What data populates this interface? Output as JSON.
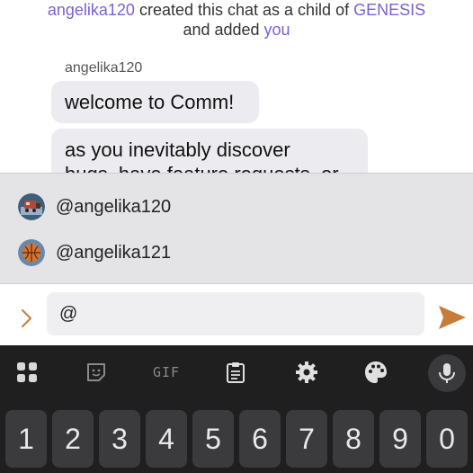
{
  "chat": {
    "system_message": {
      "creator": "angelika120",
      "text_mid": " created this chat as a child of ",
      "parent": "GENESIS",
      "text_end": "and added ",
      "target": "you"
    },
    "messages": [
      {
        "author": "angelika120",
        "text": "welcome to Comm!"
      },
      {
        "text": "as you inevitably discover",
        "text_cut": "bugs, have feature requests, or"
      }
    ]
  },
  "mentions": [
    {
      "label": "@angelika120",
      "avatar_icon": "train-avatar-icon"
    },
    {
      "label": "@angelika121",
      "avatar_icon": "basketball-avatar-icon"
    }
  ],
  "composer": {
    "value": "@",
    "expand_icon": "chevron-right-icon",
    "send_icon": "send-icon"
  },
  "keyboard": {
    "toolbar": [
      "apps-icon",
      "sticker-icon",
      "GIF",
      "clipboard-icon",
      "gear-icon",
      "palette-icon",
      "mic-icon"
    ],
    "number_row": [
      "1",
      "2",
      "3",
      "4",
      "5",
      "6",
      "7",
      "8",
      "9",
      "0"
    ]
  },
  "colors": {
    "accent": "#7b5fd6",
    "send": "#c77d3a",
    "bubble": "#ececf0",
    "suggestions_bg": "#e4e4e6",
    "keyboard_bg": "#1f1f1f",
    "key_bg": "#3b3b3d"
  }
}
